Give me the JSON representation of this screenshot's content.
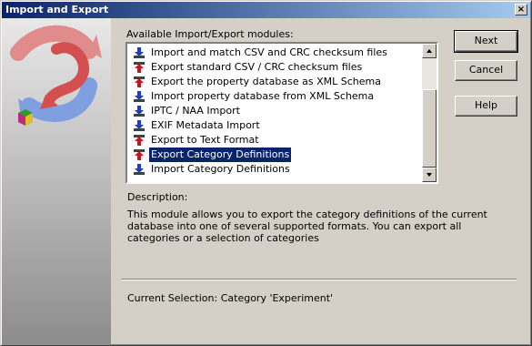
{
  "window": {
    "title": "Import and Export",
    "close_glyph": "×"
  },
  "modules_label": "Available Import/Export modules:",
  "modules": [
    {
      "label": "Import and match CSV and CRC checksum files",
      "icon": "import-arrow-icon",
      "selected": false
    },
    {
      "label": "Export standard CSV / CRC checksum files",
      "icon": "export-arrow-icon",
      "selected": false
    },
    {
      "label": "Export the property database as XML Schema",
      "icon": "export-arrow-icon",
      "selected": false
    },
    {
      "label": "Import property database from XML Schema",
      "icon": "import-arrow-icon",
      "selected": false
    },
    {
      "label": "IPTC / NAA Import",
      "icon": "import-arrow-icon",
      "selected": false
    },
    {
      "label": "EXIF Metadata Import",
      "icon": "import-arrow-icon",
      "selected": false
    },
    {
      "label": "Export to Text Format",
      "icon": "export-arrow-icon",
      "selected": false
    },
    {
      "label": "Export Category Definitions",
      "icon": "export-arrow-icon",
      "selected": true
    },
    {
      "label": "Import Category Definitions",
      "icon": "import-arrow-icon",
      "selected": false
    }
  ],
  "description_label": "Description:",
  "description_text": "This module allows you to export the category definitions of the current database into one of several supported formats. You can export all categories or a selection of categories",
  "current_selection": "Current Selection: Category 'Experiment'",
  "buttons": {
    "next": "Next",
    "cancel": "Cancel",
    "help": "Help"
  },
  "colors": {
    "import_arrow": "#1a3fc0",
    "export_arrow": "#c01818",
    "selection": "#0a246a",
    "titlebar": "#0a246a"
  }
}
